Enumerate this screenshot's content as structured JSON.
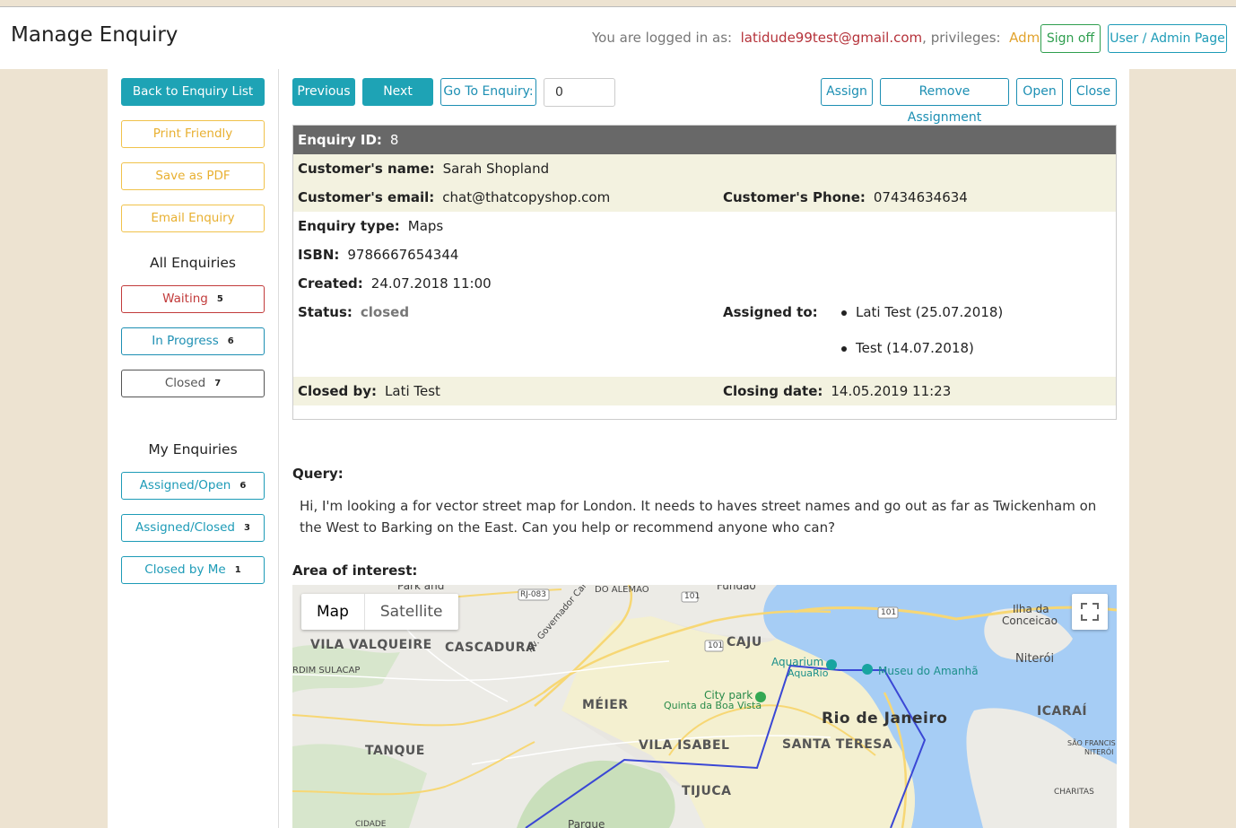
{
  "header": {
    "title": "Manage Enquiry",
    "logged_in_prefix": "You are logged in as:",
    "email": "latidude99test@gmail.com",
    "privileges_prefix": ", privileges:",
    "privileges": "Admin",
    "sign_off": "Sign off",
    "admin_page": "User / Admin Page"
  },
  "sidebar": {
    "back": "Back to Enquiry List",
    "print": "Print Friendly",
    "pdf": "Save as PDF",
    "email": "Email Enquiry",
    "all_heading": "All Enquiries",
    "all": [
      {
        "label": "Waiting",
        "count": "5"
      },
      {
        "label": "In Progress",
        "count": "6"
      },
      {
        "label": "Closed",
        "count": "7"
      }
    ],
    "my_heading": "My Enquiries",
    "my": [
      {
        "label": "Assigned/Open",
        "count": "6"
      },
      {
        "label": "Assigned/Closed",
        "count": "3"
      },
      {
        "label": "Closed by Me",
        "count": "1"
      }
    ]
  },
  "toolbar": {
    "previous": "Previous",
    "next": "Next",
    "goto": "Go To Enquiry:",
    "goto_value": "0",
    "assign": "Assign",
    "remove": "Remove Assignment",
    "open": "Open",
    "close": "Close"
  },
  "enquiry": {
    "id_label": "Enquiry ID:",
    "id": "8",
    "name_label": "Customer's name:",
    "name": "Sarah Shopland",
    "email_label": "Customer's email:",
    "email": "chat@thatcopyshop.com",
    "phone_label": "Customer's Phone:",
    "phone": "07434634634",
    "type_label": "Enquiry type:",
    "type": "Maps",
    "isbn_label": "ISBN:",
    "isbn": "9786667654344",
    "created_label": "Created:",
    "created": "24.07.2018 11:00",
    "status_label": "Status:",
    "status": "closed",
    "assigned_label": "Assigned to:",
    "assigned": [
      "Lati Test (25.07.2018)",
      "Test (14.07.2018)"
    ],
    "closedby_label": "Closed by:",
    "closedby": "Lati Test",
    "closingdate_label": "Closing date:",
    "closingdate": "14.05.2019 11:23"
  },
  "query": {
    "label": "Query:",
    "text": "Hi, I'm looking a for vector street map for London. It needs to haves street names and go out as far as Twickenham on the West to Barking on the East. Can you help or recommend anyone who can?"
  },
  "area": {
    "label": "Area of interest:",
    "map_tab": "Map",
    "satellite_tab": "Satellite",
    "labels": {
      "vila_valqueire": "VILA VALQUEIRE",
      "cascadura": "CASCADURA",
      "caju": "CAJU",
      "meier": "MÉIER",
      "vila_isabel": "VILA ISABEL",
      "rio": "Rio de Janeiro",
      "santa_teresa": "SANTA TERESA",
      "tanque": "TANQUE",
      "tijuca": "TIJUCA",
      "icarai": "ICARAÍ",
      "niteroi": "Niterói",
      "ilha": "Ilha da",
      "conceicao": "Conceicao",
      "city_park": "City park",
      "quinta": "Quinta da Boa Vista",
      "aquarium": "Aquarium",
      "aquario": "AquaRio",
      "museu": "Museu do Amanhã",
      "road": "Av. Governador Carlos Lacerda",
      "fundao": "Fundão",
      "do_alemao": "DO ALEMAO",
      "park": "Park and",
      "rdim": "RDIM SULACAP",
      "charitas": "CHARITAS",
      "sao_francisco": "SÃO FRANCIS",
      "niteroi_small": "NITERÓI",
      "parque": "Parque",
      "cidade": "CIDADE",
      "r101a": "101",
      "r101b": "101",
      "r101c": "101",
      "rj083": "RJ-083"
    }
  }
}
